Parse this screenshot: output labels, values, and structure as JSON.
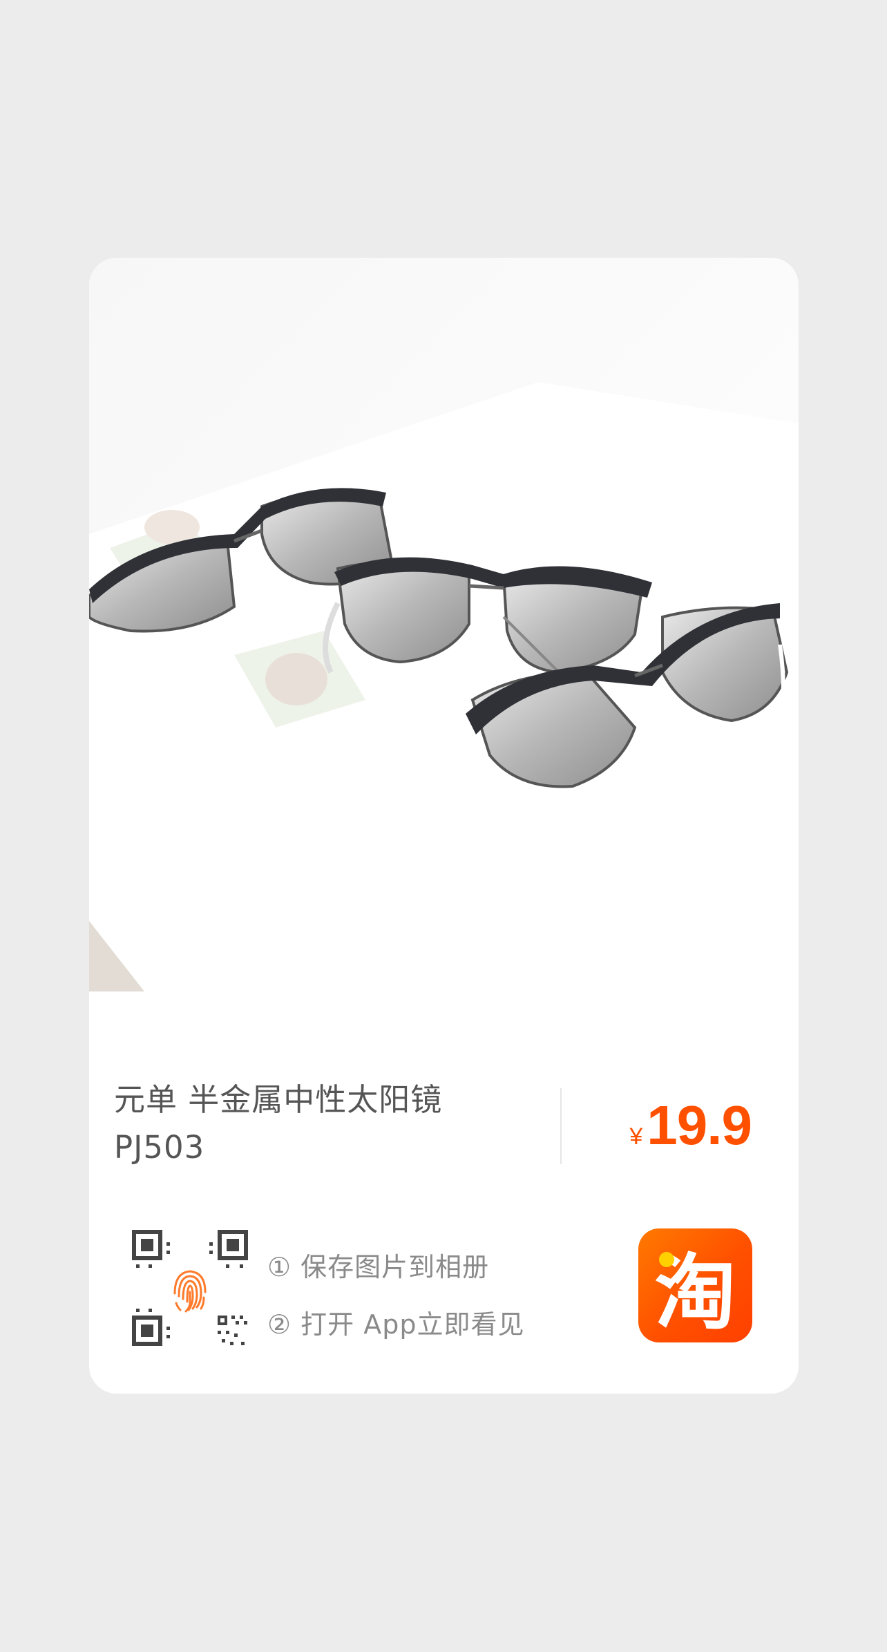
{
  "product": {
    "title_line1": "元单 半金属中性太阳镜",
    "title_line2": "PJ503",
    "currency_symbol": "¥",
    "price": "19.9"
  },
  "instructions": {
    "step1": "① 保存图片到相册",
    "step2": "② 打开 App立即看见"
  },
  "logo": {
    "char": "淘"
  },
  "colors": {
    "background": "#ececec",
    "card": "#ffffff",
    "price": "#ff5000",
    "logo_orange": "#ff5000",
    "fingerprint": "#ff7a2a"
  },
  "icons": [
    "qr-code-icon",
    "fingerprint-icon",
    "taobao-logo-icon"
  ]
}
